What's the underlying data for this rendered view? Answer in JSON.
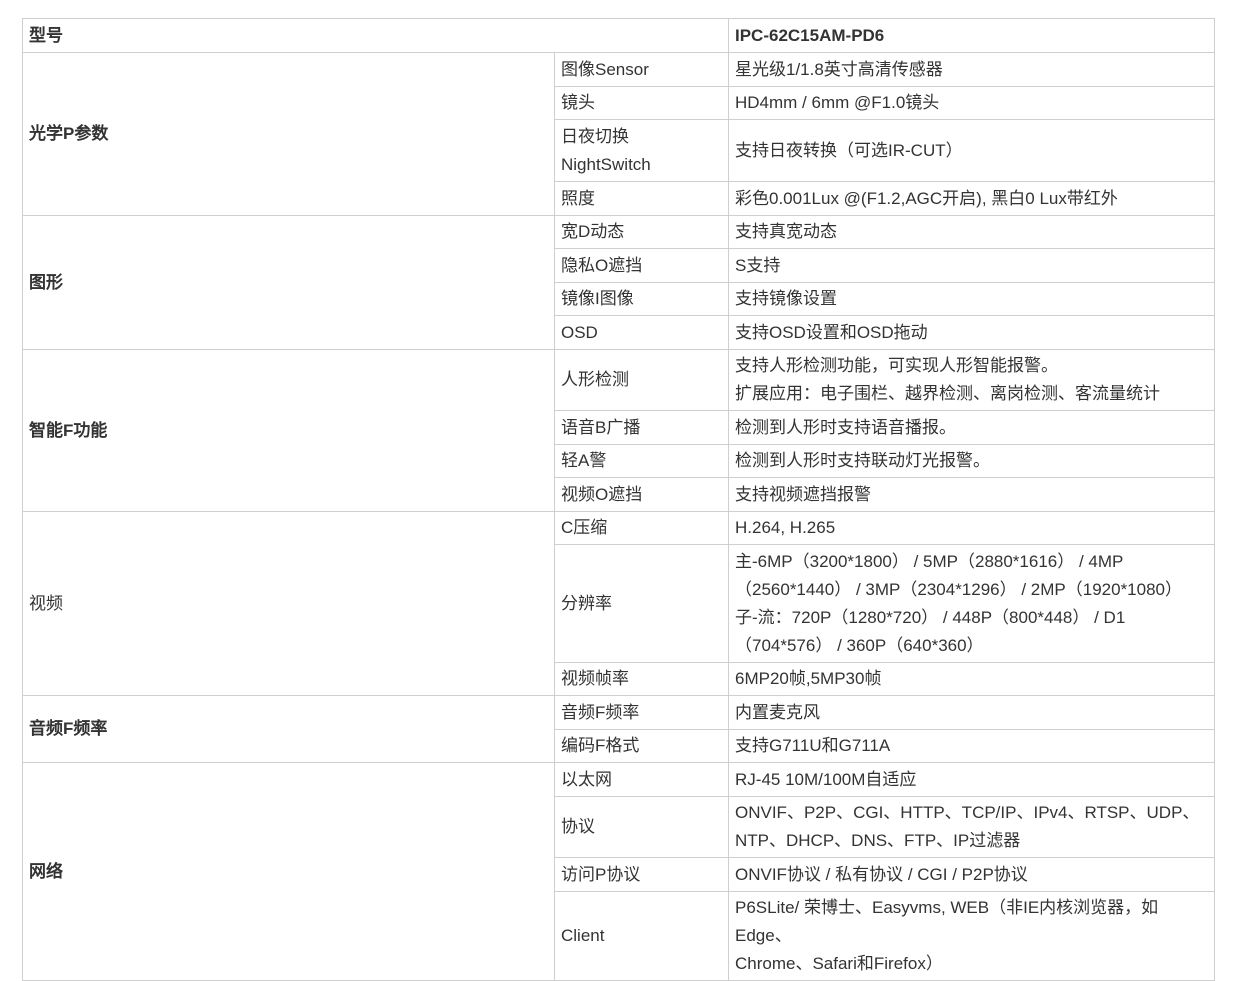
{
  "header": {
    "label": "型号",
    "model": "IPC-62C15AM-PD6"
  },
  "groups": {
    "optics": {
      "name": "光学P参数",
      "rows": [
        {
          "param": "图像Sensor",
          "value": "星光级1/1.8英寸高清传感器"
        },
        {
          "param": "镜头",
          "value": "HD4mm / 6mm @F1.0镜头"
        },
        {
          "param_line1": "日夜切换",
          "param_line2": "NightSwitch",
          "value": "支持日夜转换（可选IR-CUT）"
        },
        {
          "param": "照度",
          "value": "彩色0.001Lux @(F1.2,AGC开启), 黑白0 Lux带红外"
        }
      ]
    },
    "image": {
      "name": "图形",
      "rows": [
        {
          "param": "宽D动态",
          "value": "支持真宽动态"
        },
        {
          "param": "隐私O遮挡",
          "value": "S支持"
        },
        {
          "param": "镜像I图像",
          "value": "支持镜像设置"
        },
        {
          "param": "OSD",
          "value": "支持OSD设置和OSD拖动"
        }
      ]
    },
    "smart": {
      "name": "智能F功能",
      "rows": [
        {
          "param": "人形检测",
          "value_line1": "支持人形检测功能，可实现人形智能报警。",
          "value_line2": "扩展应用：电子围栏、越界检测、离岗检测、客流量统计"
        },
        {
          "param": "语音B广播",
          "value": "检测到人形时支持语音播报。"
        },
        {
          "param": "轻A警",
          "value": "检测到人形时支持联动灯光报警。"
        },
        {
          "param": "视频O遮挡",
          "value": "支持视频遮挡报警"
        }
      ]
    },
    "video": {
      "name": "视频",
      "rows": [
        {
          "param": "C压缩",
          "value": "H.264, H.265"
        },
        {
          "param": "分辨率",
          "value_line1": "主-6MP（3200*1800） / 5MP（2880*1616） / 4MP",
          "value_line2": "（2560*1440） / 3MP（2304*1296） / 2MP（1920*1080）",
          "value_line3": "子-流：720P（1280*720） / 448P（800*448） / D1",
          "value_line4": "（704*576） / 360P（640*360）"
        },
        {
          "param": "视频帧率",
          "value": "6MP20帧,5MP30帧"
        }
      ]
    },
    "audio": {
      "name": "音频F频率",
      "rows": [
        {
          "param": "音频F频率",
          "value": "内置麦克风"
        },
        {
          "param": "编码F格式",
          "value": "支持G711U和G711A"
        }
      ]
    },
    "network": {
      "name": "网络",
      "rows": [
        {
          "param": "以太网",
          "value": "RJ-45 10M/100M自适应"
        },
        {
          "param": "协议",
          "value_line1": "ONVIF、P2P、CGI、HTTP、TCP/IP、IPv4、RTSP、UDP、",
          "value_line2": "NTP、DHCP、DNS、FTP、IP过滤器"
        },
        {
          "param": "访问P协议",
          "value": "ONVIF协议 / 私有协议 / CGI / P2P协议"
        },
        {
          "param": "Client",
          "value_line1": "P6SLite/ 荣博士、Easyvms, WEB（非IE内核浏览器，如Edge、",
          "value_line2": "Chrome、Safari和Firefox）"
        }
      ]
    }
  }
}
